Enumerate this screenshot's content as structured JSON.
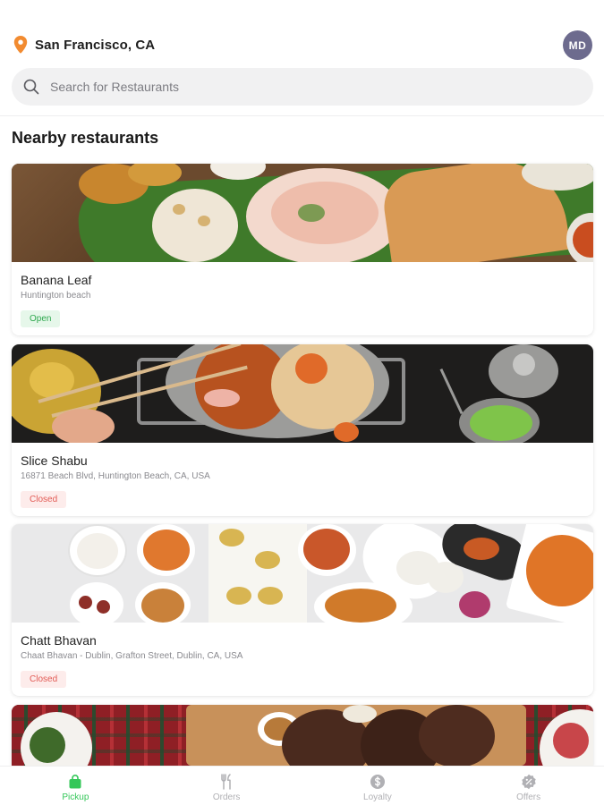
{
  "header": {
    "location": "San Francisco, CA",
    "avatar_initials": "MD"
  },
  "search": {
    "placeholder": "Search for Restaurants"
  },
  "section_title": "Nearby restaurants",
  "restaurants": [
    {
      "name": "Banana Leaf",
      "address": "Huntington beach",
      "status": "Open"
    },
    {
      "name": "Slice Shabu",
      "address": "16871 Beach Blvd, Huntington Beach, CA, USA",
      "status": "Closed"
    },
    {
      "name": "Chatt Bhavan",
      "address": "Chaat Bhavan - Dublin, Grafton Street, Dublin, CA, USA",
      "status": "Closed"
    }
  ],
  "tabs": [
    {
      "label": "Pickup",
      "icon": "shopping-bag-icon",
      "active": true
    },
    {
      "label": "Orders",
      "icon": "fork-knife-icon",
      "active": false
    },
    {
      "label": "Loyalty",
      "icon": "dollar-coin-icon",
      "active": false
    },
    {
      "label": "Offers",
      "icon": "discount-badge-icon",
      "active": false
    }
  ],
  "colors": {
    "accent_green": "#34C759",
    "pin_orange": "#F28B30",
    "avatar_bg": "#6D6B8E",
    "open_text": "#2EA84E",
    "closed_text": "#E25B55"
  }
}
